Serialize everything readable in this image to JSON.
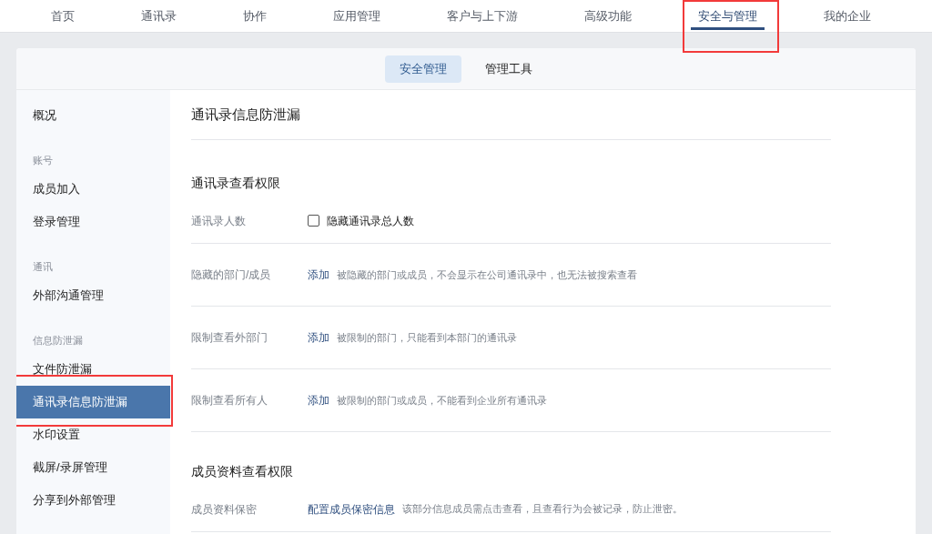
{
  "top_nav": [
    {
      "label": "首页",
      "selected": false,
      "highlighted": false
    },
    {
      "label": "通讯录",
      "selected": false,
      "highlighted": false
    },
    {
      "label": "协作",
      "selected": false,
      "highlighted": false
    },
    {
      "label": "应用管理",
      "selected": false,
      "highlighted": false
    },
    {
      "label": "客户与上下游",
      "selected": false,
      "highlighted": false
    },
    {
      "label": "高级功能",
      "selected": false,
      "highlighted": false
    },
    {
      "label": "安全与管理",
      "selected": true,
      "highlighted": true
    },
    {
      "label": "我的企业",
      "selected": false,
      "highlighted": false
    }
  ],
  "sub_tabs": [
    {
      "label": "安全管理",
      "selected": true
    },
    {
      "label": "管理工具",
      "selected": false
    }
  ],
  "sidebar": {
    "groups": [
      {
        "items": [
          {
            "label": "概况",
            "selected": false,
            "highlighted": false
          }
        ]
      },
      {
        "title": "账号",
        "items": [
          {
            "label": "成员加入",
            "selected": false,
            "highlighted": false
          },
          {
            "label": "登录管理",
            "selected": false,
            "highlighted": false
          }
        ]
      },
      {
        "title": "通讯",
        "items": [
          {
            "label": "外部沟通管理",
            "selected": false,
            "highlighted": false
          }
        ]
      },
      {
        "title": "信息防泄漏",
        "items": [
          {
            "label": "文件防泄漏",
            "selected": false,
            "highlighted": false
          },
          {
            "label": "通讯录信息防泄漏",
            "selected": true,
            "highlighted": true
          },
          {
            "label": "水印设置",
            "selected": false,
            "highlighted": false
          },
          {
            "label": "截屏/录屏管理",
            "selected": false,
            "highlighted": false
          },
          {
            "label": "分享到外部管理",
            "selected": false,
            "highlighted": false
          }
        ]
      }
    ]
  },
  "content": {
    "title": "通讯录信息防泄漏",
    "sections": [
      {
        "title": "通讯录查看权限",
        "rows": [
          {
            "kind": "checkbox",
            "label": "通讯录人数",
            "option": "隐藏通讯录总人数",
            "checked": false
          },
          {
            "kind": "action",
            "label": "隐藏的部门/成员",
            "action": "添加",
            "description": "被隐藏的部门或成员，不会显示在公司通讯录中，也无法被搜索查看"
          },
          {
            "kind": "action",
            "label": "限制查看外部门",
            "action": "添加",
            "description": "被限制的部门，只能看到本部门的通讯录"
          },
          {
            "kind": "action",
            "label": "限制查看所有人",
            "action": "添加",
            "description": "被限制的部门或成员，不能看到企业所有通讯录"
          }
        ]
      },
      {
        "title": "成员资料查看权限",
        "rows": [
          {
            "kind": "action",
            "label": "成员资料保密",
            "action": "配置成员保密信息",
            "description": "该部分信息成员需点击查看，且查看行为会被记录，防止泄密。"
          }
        ]
      }
    ]
  }
}
